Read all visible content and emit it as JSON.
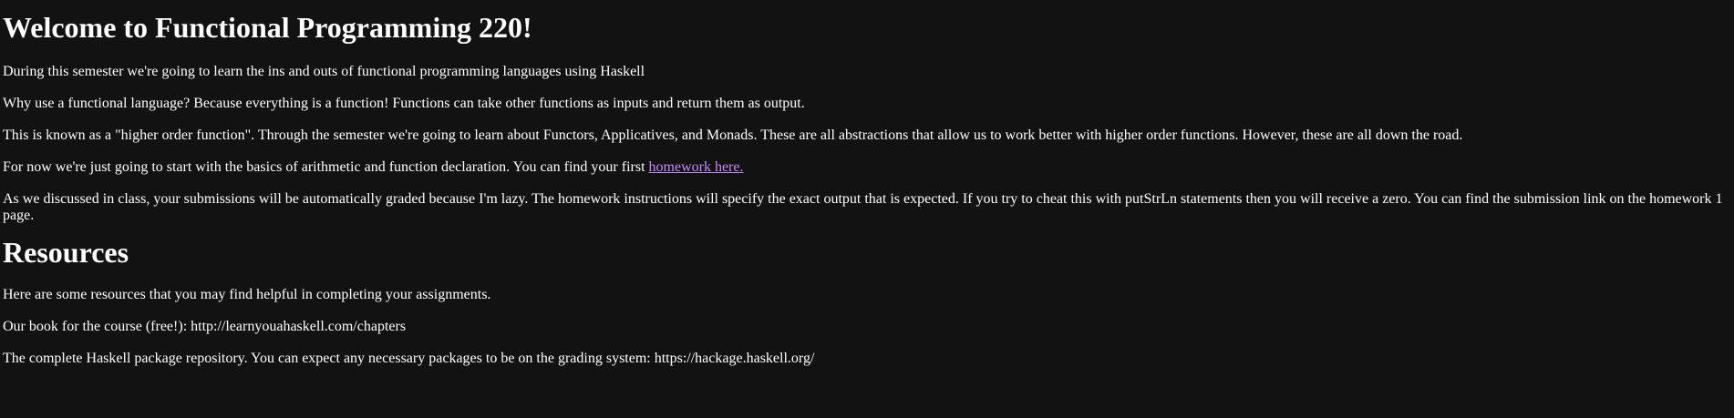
{
  "main": {
    "title": "Welcome to Functional Programming 220!",
    "para1": "During this semester we're going to learn the ins and outs of functional programming languages using Haskell",
    "para2": "Why use a functional language? Because everything is a function! Functions can take other functions as inputs and return them as output.",
    "para3": "This is known as a \"higher order function\". Through the semester we're going to learn about Functors, Applicatives, and Monads. These are all abstractions that allow us to work better with higher order functions. However, these are all down the road.",
    "para4_prefix": "For now we're just going to start with the basics of arithmetic and function declaration. You can find your first ",
    "homework_link": "homework here.",
    "para5": "As we discussed in class, your submissions will be automatically graded because I'm lazy. The homework instructions will specify the exact output that is expected. If you try to cheat this with putStrLn statements then you will receive a zero. You can find the submission link on the homework 1 page."
  },
  "resources": {
    "heading": "Resources",
    "intro": "Here are some resources that you may find helpful in completing your assignments.",
    "book": "Our book for the course (free!): http://learnyouahaskell.com/chapters",
    "hackage": "The complete Haskell package repository. You can expect any necessary packages to be on the grading system: https://hackage.haskell.org/"
  },
  "colors": {
    "background": "#121212",
    "text": "#ffffff",
    "link": "#c58af9"
  }
}
